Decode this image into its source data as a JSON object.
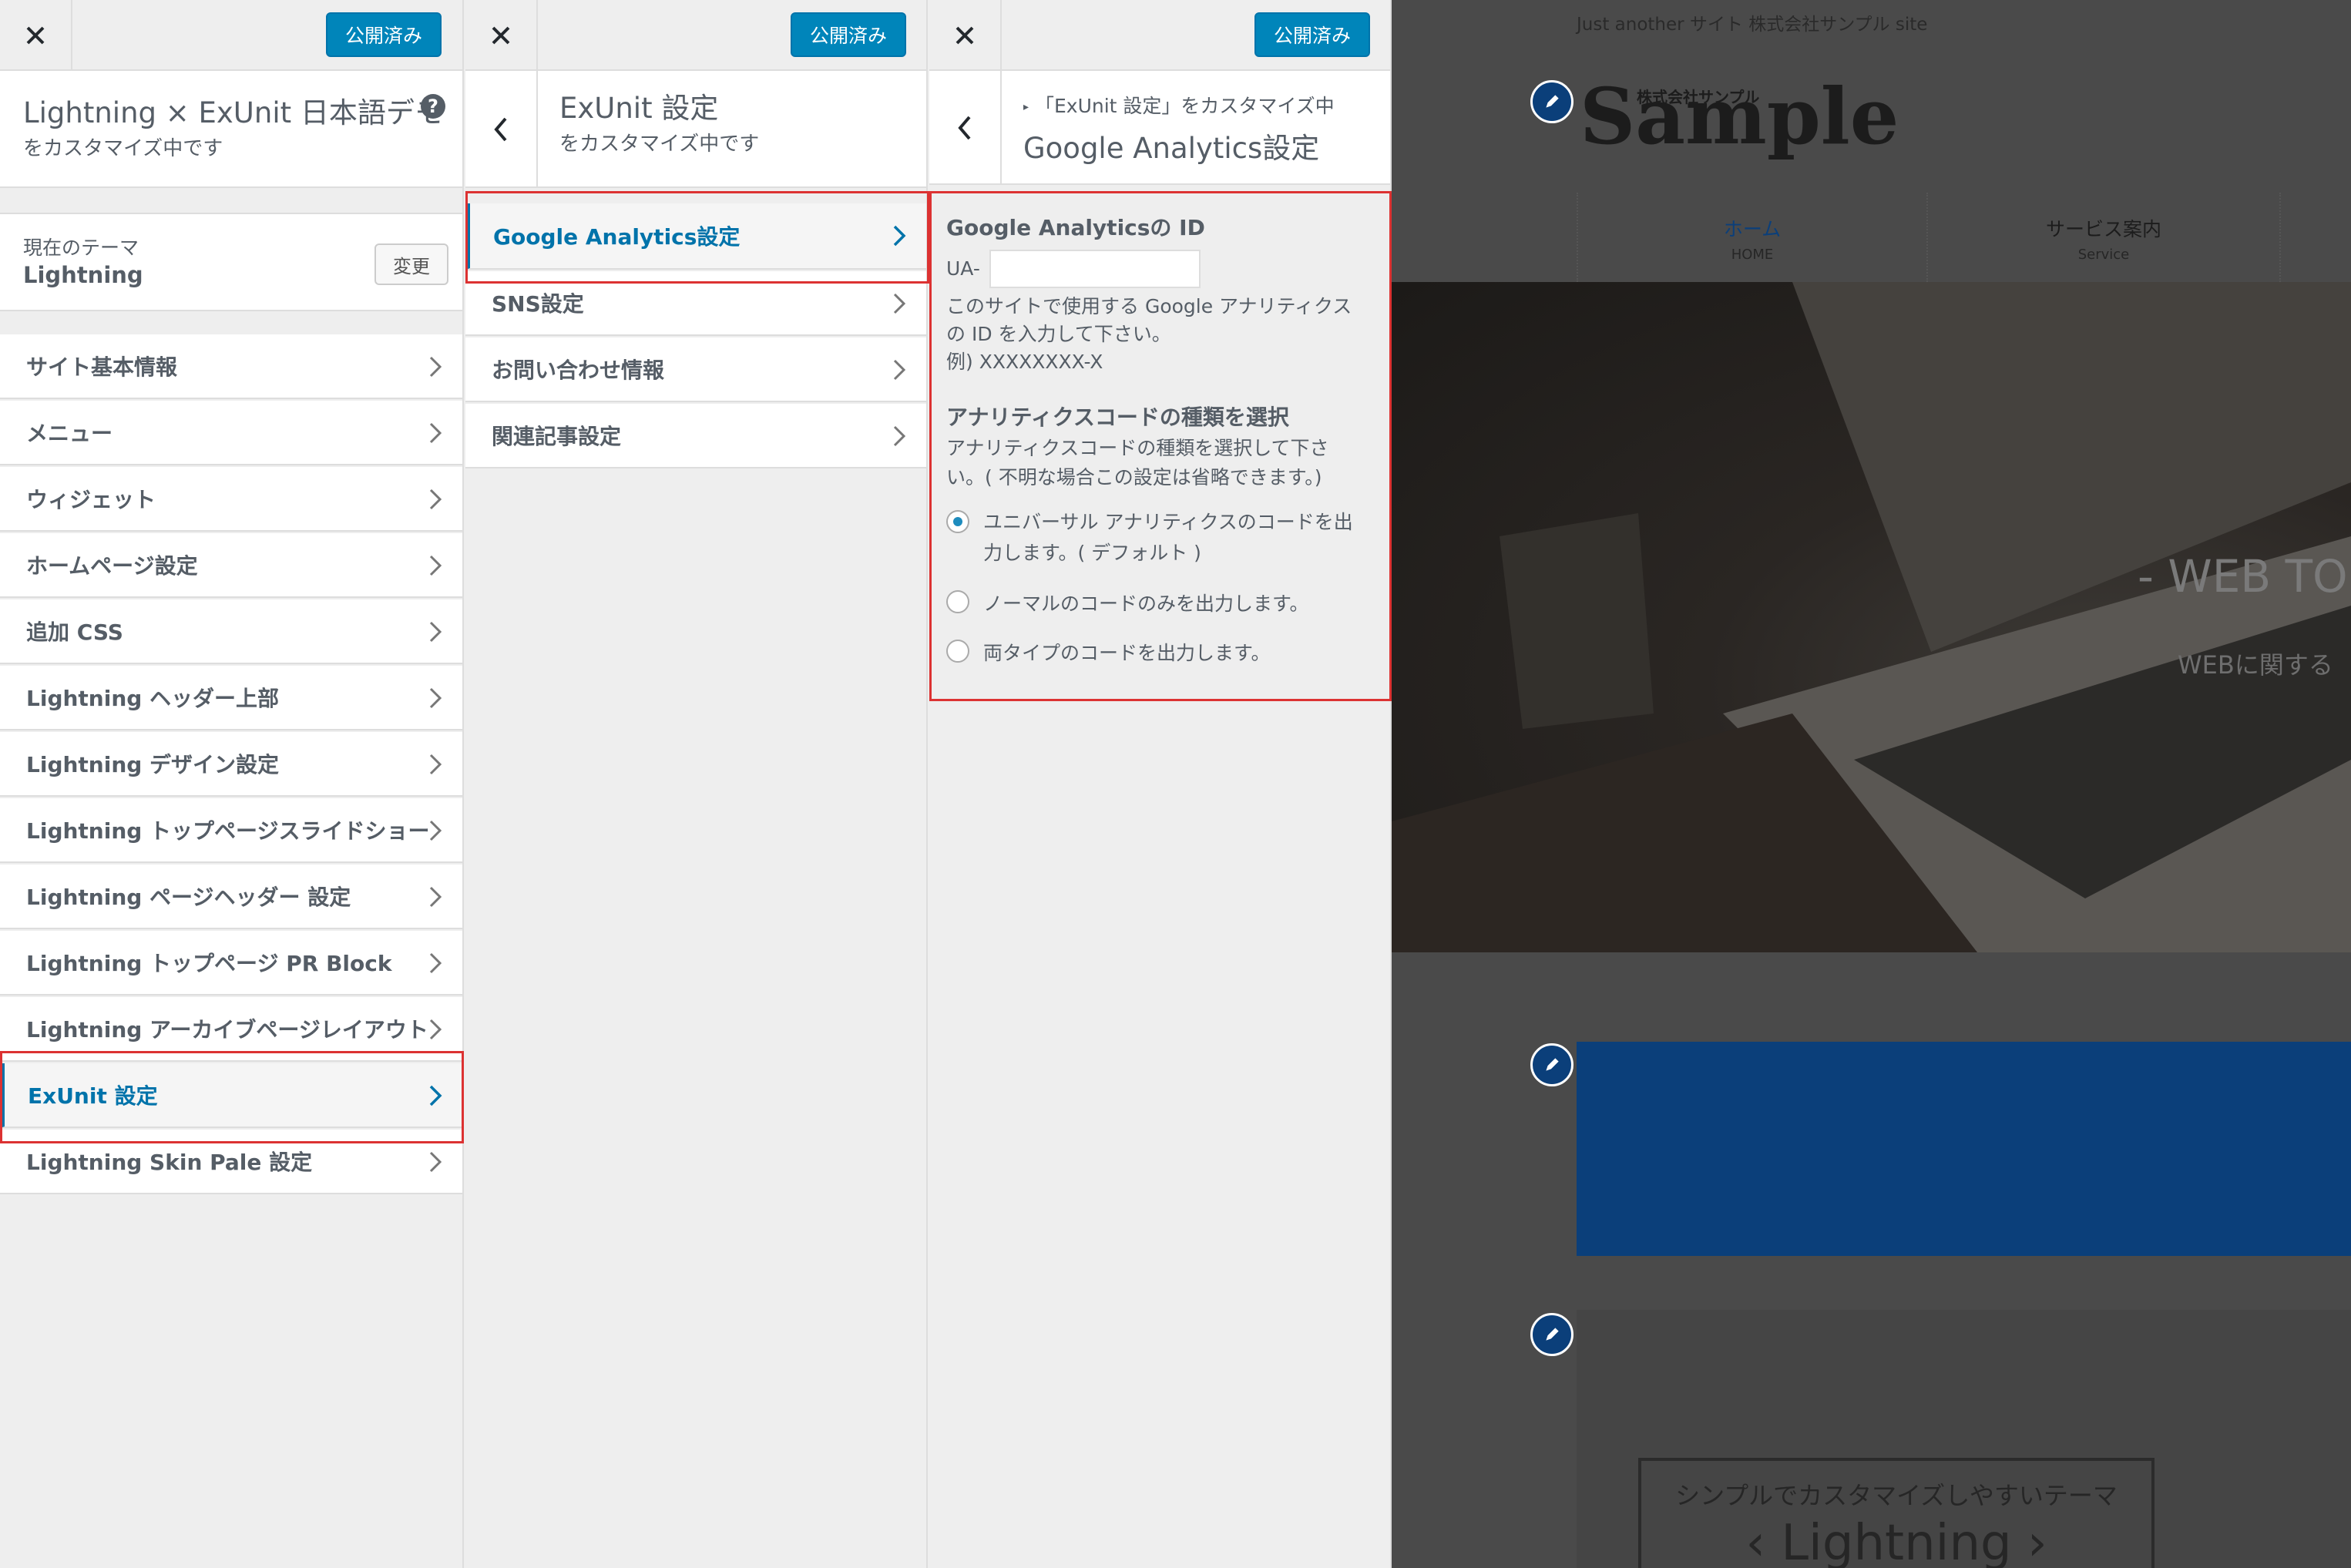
{
  "publish_label": "公開済み",
  "panel1": {
    "title": "Lightning × ExUnit 日本語デモ",
    "subtitle": "をカスタマイズ中です",
    "current_theme_label": "現在のテーマ",
    "current_theme_name": "Lightning",
    "change_label": "変更",
    "sections": [
      "サイト基本情報",
      "メニュー",
      "ウィジェット",
      "ホームページ設定",
      "追加 CSS",
      "Lightning ヘッダー上部",
      "Lightning デザイン設定",
      "Lightning トップページスライドショー",
      "Lightning ページヘッダー 設定",
      "Lightning トップページ PR Block",
      "Lightning アーカイブページレイアウト",
      "ExUnit 設定",
      "Lightning Skin Pale 設定"
    ]
  },
  "panel2": {
    "title": "ExUnit 設定",
    "subtitle": "をカスタマイズ中です",
    "sections": [
      "Google Analytics設定",
      "SNS設定",
      "お問い合わせ情報",
      "関連記事設定"
    ]
  },
  "panel3": {
    "breadcrumb": "「ExUnit 設定」をカスタマイズ中",
    "title": "Google Analytics設定",
    "id_label": "Google Analyticsの ID",
    "ua_prefix": "UA-",
    "ua_value": "",
    "id_desc_1": "このサイトで使用する Google アナリティクス",
    "id_desc_2": "の ID を入力して下さい。",
    "id_example": "例) XXXXXXXX-X",
    "type_label": "アナリティクスコードの種類を選択",
    "type_desc_1": "アナリティクスコードの種類を選択して下さ",
    "type_desc_2": "い。( 不明な場合この設定は省略できます。)",
    "options": [
      {
        "line1": "ユニバーサル アナリティクスのコードを出",
        "line2": "力します。( デフォルト )",
        "checked": true
      },
      {
        "line1": "ノーマルのコードのみを出力します。",
        "line2": "",
        "checked": false
      },
      {
        "line1": "両タイプのコードを出力します。",
        "line2": "",
        "checked": false
      }
    ]
  },
  "preview": {
    "tagline": "Just another サイト 株式会社サンプル site",
    "logo_small": "株式会社サンプル",
    "logo_big": "Sample",
    "nav": [
      {
        "label": "ホーム",
        "sub": "HOME"
      },
      {
        "label": "サービス案内",
        "sub": "Service"
      }
    ],
    "hero_title": "- WEB TO",
    "hero_sub": "WEBに関する",
    "box_text": "シンプルでカスタマイズしやすいテーマ",
    "box_brand": "Lightning"
  },
  "colors": {
    "accent": "#0073aa",
    "publish": "#0085ba",
    "highlight": "#dc3232",
    "preview_blue": "#0b3f7a"
  }
}
